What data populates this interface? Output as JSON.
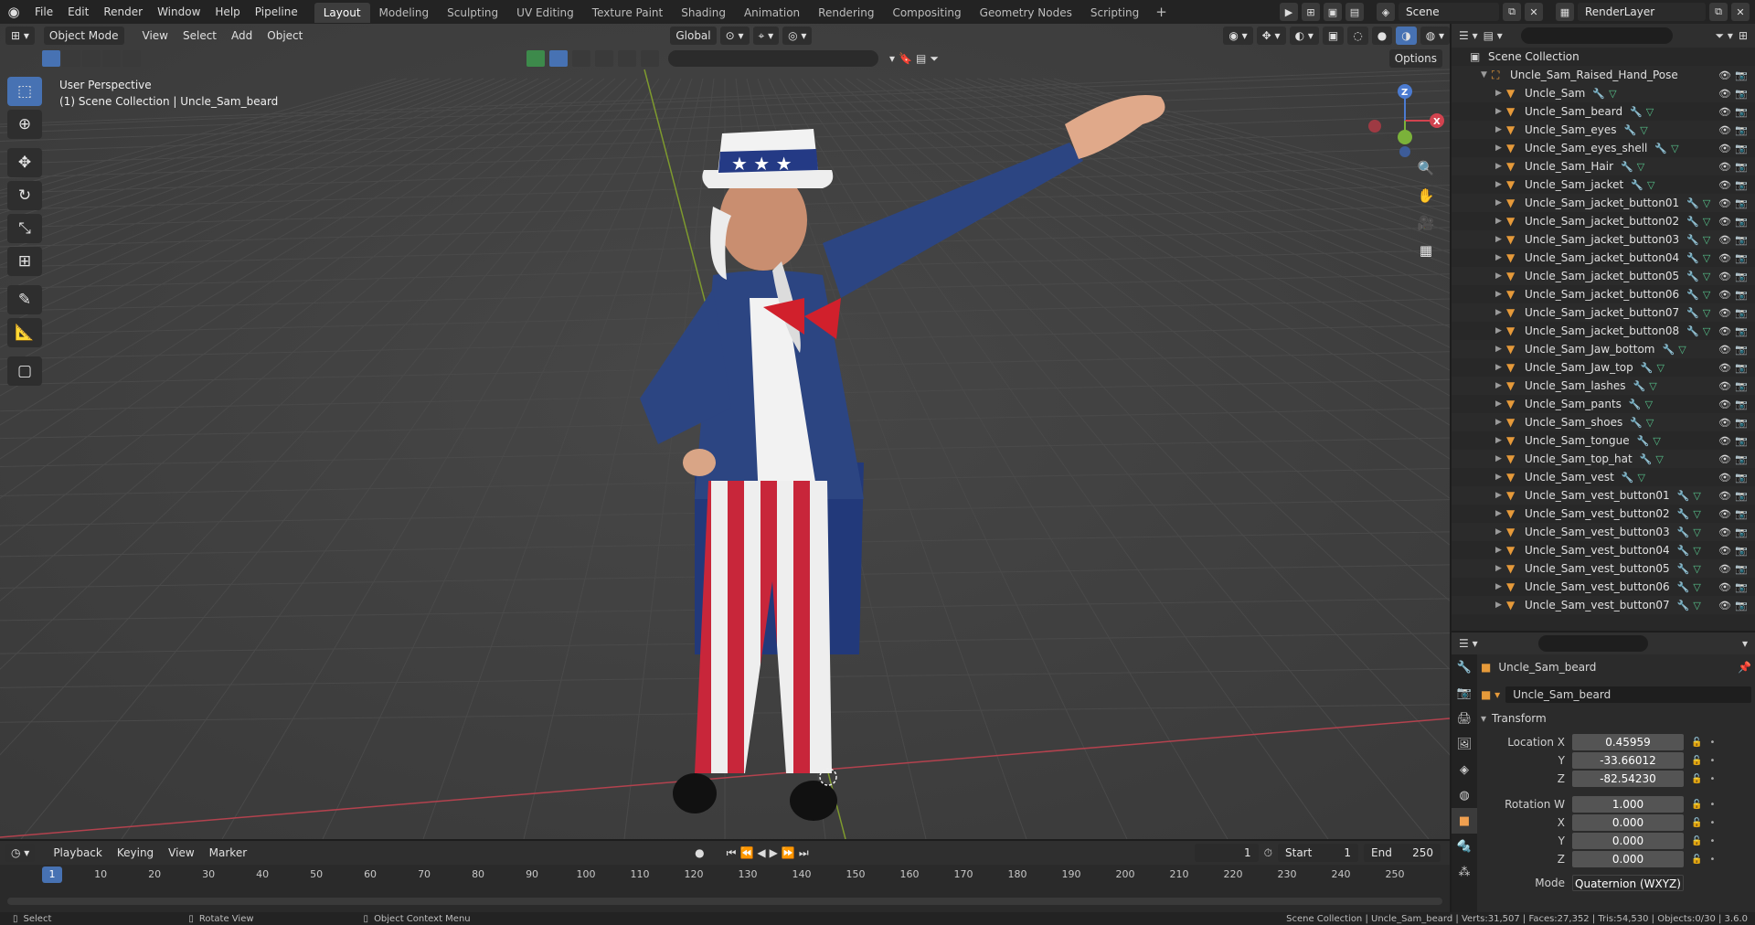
{
  "menus": [
    "File",
    "Edit",
    "Render",
    "Window",
    "Help",
    "Pipeline"
  ],
  "workspaces": [
    "Layout",
    "Modeling",
    "Sculpting",
    "UV Editing",
    "Texture Paint",
    "Shading",
    "Animation",
    "Rendering",
    "Compositing",
    "Geometry Nodes",
    "Scripting"
  ],
  "active_workspace": "Layout",
  "scene_name": "Scene",
  "render_layer": "RenderLayer",
  "viewport": {
    "mode": "Object Mode",
    "menus": [
      "View",
      "Select",
      "Add",
      "Object"
    ],
    "transform_orientation": "Global",
    "options_label": "Options",
    "overlay_line1": "User Perspective",
    "overlay_line2": "(1) Scene Collection | Uncle_Sam_beard"
  },
  "outliner": {
    "root": "Scene Collection",
    "collection": "Uncle_Sam_Raised_Hand_Pose",
    "items": [
      "Uncle_Sam",
      "Uncle_Sam_beard",
      "Uncle_Sam_eyes",
      "Uncle_Sam_eyes_shell",
      "Uncle_Sam_Hair",
      "Uncle_Sam_jacket",
      "Uncle_Sam_jacket_button01",
      "Uncle_Sam_jacket_button02",
      "Uncle_Sam_jacket_button03",
      "Uncle_Sam_jacket_button04",
      "Uncle_Sam_jacket_button05",
      "Uncle_Sam_jacket_button06",
      "Uncle_Sam_jacket_button07",
      "Uncle_Sam_jacket_button08",
      "Uncle_Sam_Jaw_bottom",
      "Uncle_Sam_Jaw_top",
      "Uncle_Sam_lashes",
      "Uncle_Sam_pants",
      "Uncle_Sam_shoes",
      "Uncle_Sam_tongue",
      "Uncle_Sam_top_hat",
      "Uncle_Sam_vest",
      "Uncle_Sam_vest_button01",
      "Uncle_Sam_vest_button02",
      "Uncle_Sam_vest_button03",
      "Uncle_Sam_vest_button04",
      "Uncle_Sam_vest_button05",
      "Uncle_Sam_vest_button06",
      "Uncle_Sam_vest_button07"
    ]
  },
  "properties": {
    "object_name": "Uncle_Sam_beard",
    "object_field": "Uncle_Sam_beard",
    "panel": "Transform",
    "location": {
      "x_label": "Location X",
      "x": "0.45959",
      "y_label": "Y",
      "y": "-33.66012",
      "z_label": "Z",
      "z": "-82.54230"
    },
    "rotation": {
      "w_label": "Rotation W",
      "w": "1.000",
      "x_label": "X",
      "x": "0.000",
      "y_label": "Y",
      "y": "0.000",
      "z_label": "Z",
      "z": "0.000"
    },
    "mode_label": "Mode",
    "mode_value": "Quaternion (WXYZ)"
  },
  "timeline": {
    "menus": [
      "Playback",
      "Keying",
      "View",
      "Marker"
    ],
    "current_frame": "1",
    "start_label": "Start",
    "start": "1",
    "end_label": "End",
    "end": "250",
    "ticks": [
      "10",
      "20",
      "30",
      "40",
      "50",
      "60",
      "70",
      "80",
      "90",
      "100",
      "110",
      "120",
      "130",
      "140",
      "150",
      "160",
      "170",
      "180",
      "190",
      "200",
      "210",
      "220",
      "230",
      "240",
      "250"
    ],
    "playhead": "1"
  },
  "status": {
    "select": "Select",
    "rotate": "Rotate View",
    "context": "Object Context Menu",
    "info": "Scene Collection | Uncle_Sam_beard | Verts:31,507 | Faces:27,352 | Tris:54,530 | Objects:0/30 | 3.6.0"
  }
}
